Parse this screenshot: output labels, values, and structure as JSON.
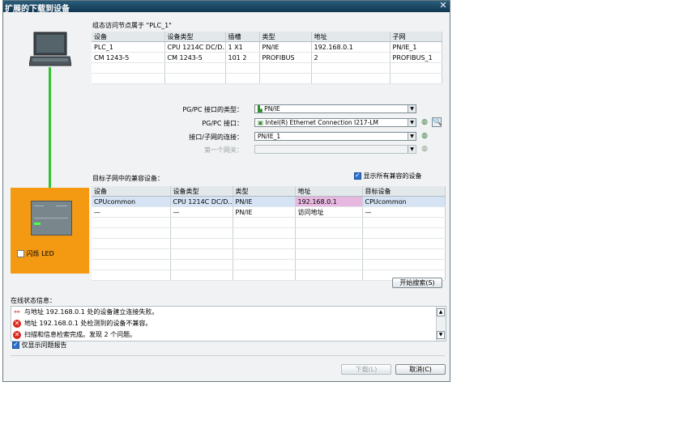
{
  "window": {
    "title": "扩展的下载到设备",
    "close": "✕"
  },
  "configured_access": {
    "caption": "组态访问节点属于 \"PLC_1\"",
    "columns": [
      "设备",
      "设备类型",
      "插槽",
      "类型",
      "地址",
      "子网"
    ],
    "rows": [
      [
        "PLC_1",
        "CPU 1214C DC/D...",
        "1 X1",
        "PN/IE",
        "192.168.0.1",
        "PN/IE_1"
      ],
      [
        "CM 1243-5",
        "CM 1243-5",
        "101 2",
        "PROFIBUS",
        "2",
        "PROFIBUS_1"
      ]
    ]
  },
  "interface": {
    "type_label": "PG/PC 接口的类型：",
    "type_value": "PN/IE",
    "pgpc_label": "PG/PC 接口：",
    "pgpc_value": "Intel(R) Ethernet Connection I217-LM",
    "subnet_label": "接口/子网的连接：",
    "subnet_value": "PN/IE_1",
    "gateway_label": "第一个网关：",
    "gateway_value": ""
  },
  "target": {
    "caption": "目标子网中的兼容设备：",
    "show_all_label": "显示所有兼容的设备",
    "show_all_checked": true,
    "columns": [
      "设备",
      "设备类型",
      "类型",
      "地址",
      "目标设备"
    ],
    "rows": [
      [
        "CPUcommon",
        "CPU 1214C DC/D...",
        "PN/IE",
        "192.168.0.1",
        "CPUcommon"
      ],
      [
        "—",
        "—",
        "PN/IE",
        "访问地址",
        "—"
      ]
    ]
  },
  "flash_led_label": "闪烁 LED",
  "start_search_label": "开始搜索(S)",
  "online_status": {
    "caption": "在线状态信息：",
    "messages": [
      "与地址 192.168.0.1 处的设备建立连接失败。",
      "地址 192.168.0.1 处检测到的设备不兼容。",
      "扫描和信息检索完成。发现 2 个问题。"
    ],
    "only_errors_label": "仅显示问题报告",
    "only_errors_checked": true
  },
  "footer": {
    "download_label": "下载(L)",
    "cancel_label": "取消(C)"
  }
}
